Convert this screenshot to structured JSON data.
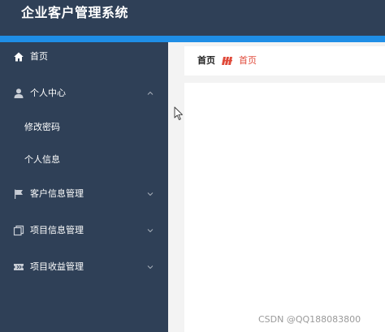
{
  "app": {
    "title": "企业客户管理系统"
  },
  "sidebar": {
    "items": [
      {
        "label": "首页",
        "icon": "home-icon"
      },
      {
        "label": "个人中心",
        "icon": "user-icon",
        "expanded": true,
        "children": [
          {
            "label": "修改密码"
          },
          {
            "label": "个人信息"
          }
        ]
      },
      {
        "label": "客户信息管理",
        "icon": "flag-icon",
        "expanded": false
      },
      {
        "label": "项目信息管理",
        "icon": "copy-icon",
        "expanded": false
      },
      {
        "label": "项目收益管理",
        "icon": "ticket-icon",
        "expanded": false
      }
    ]
  },
  "breadcrumb": {
    "home": "首页",
    "current": "首页",
    "separator_icon": "tag-icon"
  },
  "watermark": "CSDN @QQ188083800",
  "colors": {
    "header_bg": "#2f4057",
    "sidebar_bg": "#2f4057",
    "accent_bar": "#1f8ee6",
    "breadcrumb_current": "#e04a3a",
    "content_bg": "#f3f3f3"
  }
}
